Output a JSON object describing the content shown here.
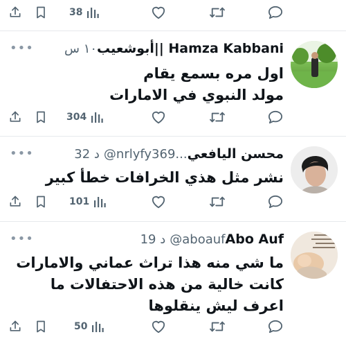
{
  "top_bar": {
    "views": "38"
  },
  "tweets": [
    {
      "name": "أبوشعيب|| Hamza Kabbani",
      "handle": "",
      "time": "١٠ س",
      "body": "اول مره بسمع يقام\nمولد النبوي في الامارات",
      "views": "304"
    },
    {
      "name": "محسن اليافعي",
      "handle": "@nrlyfy369...",
      "time": "32 د",
      "body": "نشر مثل هذي الخرافات خطأ كبير",
      "views": "101"
    },
    {
      "name": "Abo Auf",
      "handle": "@aboauf",
      "time": "19 د",
      "body": "ما شي منه هذا تراث عماني والامارات كانت خالية من هذه الاحتفالات ما اعرف ليش ينقلوها",
      "views": "50"
    }
  ],
  "icons": {
    "share": "share-icon",
    "bookmark": "bookmark-icon",
    "views": "analytics-icon",
    "like": "heart-icon",
    "retweet": "retweet-icon",
    "reply": "reply-icon",
    "more": "more-options-icon"
  },
  "colors": {
    "icon": "#536471",
    "text": "#0f1419",
    "divider": "#e6e9ec"
  }
}
